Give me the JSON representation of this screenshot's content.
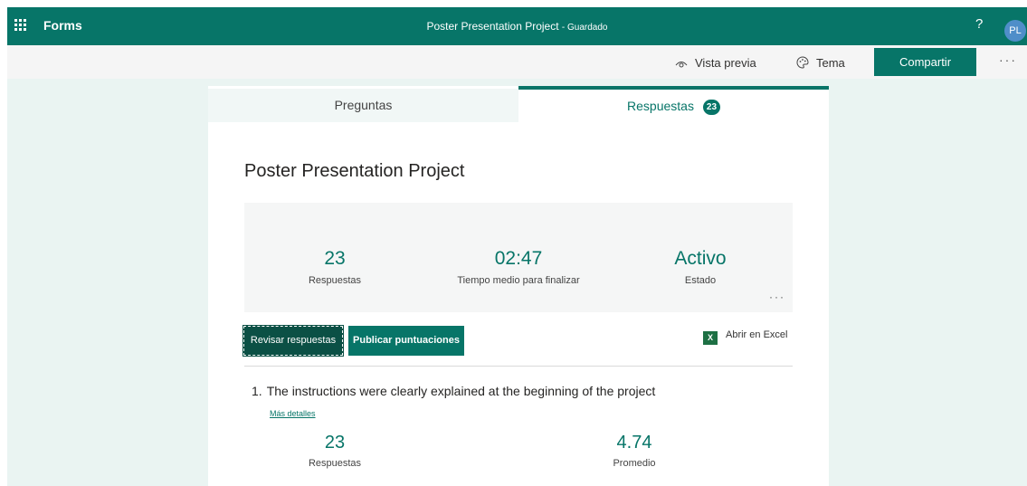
{
  "header": {
    "app_name": "Forms",
    "doc_title": "Poster Presentation Project",
    "doc_status": "- Guardado",
    "help": "?",
    "avatar_initials": "PL",
    "bg_color": "#077568"
  },
  "toolbar": {
    "preview_label": "Vista previa",
    "theme_label": "Tema",
    "share_label": "Compartir",
    "more": "···"
  },
  "tabs": {
    "questions_label": "Preguntas",
    "responses_label": "Respuestas",
    "responses_count": "23"
  },
  "form": {
    "title": "Poster Presentation Project"
  },
  "summary": {
    "responses_value": "23",
    "responses_label": "Respuestas",
    "avg_time_value": "02:47",
    "avg_time_label": "Tiempo medio para finalizar",
    "status_value": "Activo",
    "status_label": "Estado",
    "more": "···"
  },
  "actions": {
    "review_label": "Revisar respuestas",
    "publish_label": "Publicar puntuaciones",
    "excel_label": "Abrir en Excel",
    "excel_icon": "X"
  },
  "question1": {
    "number": "1.",
    "text": "The instructions were clearly explained at the beginning of the project",
    "more_details": "Más detalles",
    "responses_value": "23",
    "responses_label": "Respuestas",
    "average_value": "4.74",
    "average_label": "Promedio"
  },
  "icons": {
    "app_launcher": "waffle-icon",
    "preview": "eye-icon",
    "theme": "palette-icon",
    "excel": "excel-icon"
  }
}
